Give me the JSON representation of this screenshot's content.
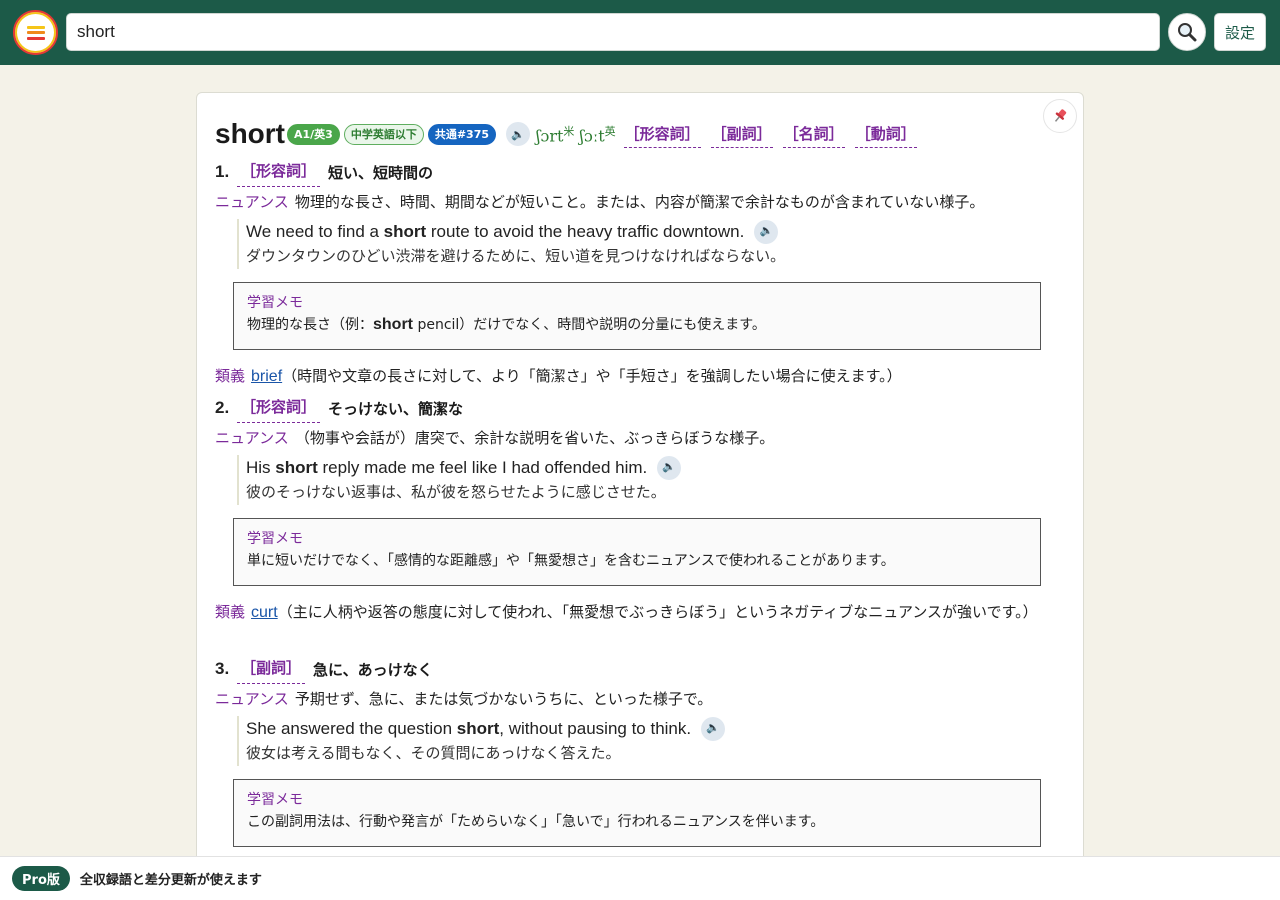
{
  "header": {
    "search_value": "short",
    "search_placeholder": "",
    "settings_label": "設定",
    "logo_colors": [
      "#f5c518",
      "#f08a1c",
      "#e53935"
    ]
  },
  "entry": {
    "headword": "short",
    "badges": {
      "level": "A1/英3",
      "grade": "中学英語以下",
      "common": "共通#375"
    },
    "ipa_us": "ʃɔrt",
    "ipa_us_mark": "米",
    "ipa_uk": "ʃɔːt",
    "ipa_uk_mark": "英",
    "pos_links": [
      "［形容詞］",
      "［副詞］",
      "［名詞］",
      "［動詞］"
    ]
  },
  "senses": [
    {
      "num": "1.",
      "pos": "［形容詞］",
      "gloss": "短い、短時間の",
      "nuance_tag": "ニュアンス",
      "nuance": "物理的な長さ、時間、期間などが短いこと。または、内容が簡潔で余計なものが含まれていない様子。",
      "example_pre": "We need to find a ",
      "example_key": "short",
      "example_post": " route to avoid the heavy traffic downtown.",
      "example_ja": "ダウンタウンのひどい渋滞を避けるために、短い道を見つけなければならない。",
      "memo_title": "学習メモ",
      "memo_pre": "物理的な長さ（例：",
      "memo_key": "short",
      "memo_post": " pencil）だけでなく、時間や説明の分量にも使えます。",
      "syn_tag": "類義",
      "syn_word": "brief",
      "syn_note": "（時間や文章の長さに対して、より「簡潔さ」や「手短さ」を強調したい場合に使えます。）"
    },
    {
      "num": "2.",
      "pos": "［形容詞］",
      "gloss": "そっけない、簡潔な",
      "nuance_tag": "ニュアンス",
      "nuance": "（物事や会話が）唐突で、余計な説明を省いた、ぶっきらぼうな様子。",
      "example_pre": "His ",
      "example_key": "short",
      "example_post": " reply made me feel like I had offended him.",
      "example_ja": "彼のそっけない返事は、私が彼を怒らせたように感じさせた。",
      "memo_title": "学習メモ",
      "memo_body": "単に短いだけでなく、「感情的な距離感」や「無愛想さ」を含むニュアンスで使われることがあります。",
      "syn_tag": "類義",
      "syn_word": "curt",
      "syn_note": "（主に人柄や返答の態度に対して使われ、「無愛想でぶっきらぼう」というネガティブなニュアンスが強いです。）"
    },
    {
      "num": "3.",
      "pos": "［副詞］",
      "gloss": "急に、あっけなく",
      "nuance_tag": "ニュアンス",
      "nuance": "予期せず、急に、または気づかないうちに、といった様子で。",
      "example_pre": "She answered the question ",
      "example_key": "short",
      "example_post": ", without pausing to think.",
      "example_ja": "彼女は考える間もなく、その質問にあっけなく答えた。",
      "memo_title": "学習メモ",
      "memo_body": "この副詞用法は、行動や発言が「ためらいなく」「急いで」行われるニュアンスを伴います。"
    }
  ],
  "footer": {
    "pro_label": "Pro版",
    "text": "全収録語と差分更新が使えます"
  },
  "colors": {
    "header_bg": "#1c5a48",
    "accent_purple": "#7b2a9a",
    "ipa_green": "#2e7d32",
    "link_blue": "#1a55a8"
  }
}
